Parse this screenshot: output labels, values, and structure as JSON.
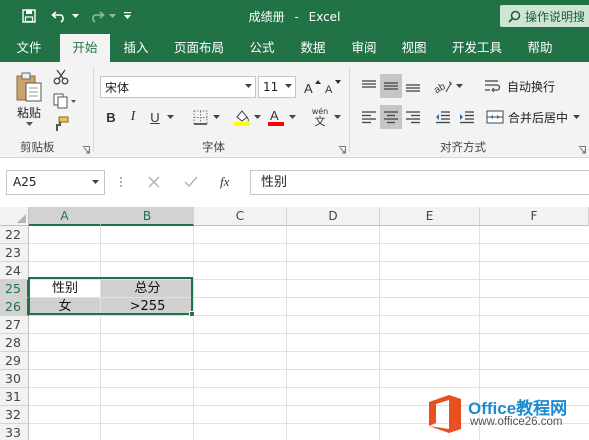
{
  "titlebar": {
    "doc_title": "成绩册",
    "separator": "-",
    "app_name": "Excel",
    "tell_me": "操作说明搜",
    "bg_color": "#217346"
  },
  "tabs": [
    {
      "label": "文件",
      "active": false
    },
    {
      "label": "开始",
      "active": true
    },
    {
      "label": "插入",
      "active": false
    },
    {
      "label": "页面布局",
      "active": false
    },
    {
      "label": "公式",
      "active": false
    },
    {
      "label": "数据",
      "active": false
    },
    {
      "label": "审阅",
      "active": false
    },
    {
      "label": "视图",
      "active": false
    },
    {
      "label": "开发工具",
      "active": false
    },
    {
      "label": "帮助",
      "active": false
    }
  ],
  "ribbon": {
    "clipboard": {
      "paste_label": "粘贴",
      "group_label": "剪贴板"
    },
    "font": {
      "font_name": "宋体",
      "font_size": "11",
      "bold": "B",
      "italic": "I",
      "underline": "U",
      "phonetic": "wén",
      "group_label": "字体",
      "highlight_color": "#ffff00",
      "font_color": "#ff0000"
    },
    "alignment": {
      "wrap_text": "自动换行",
      "merge_center": "合并后居中",
      "group_label": "对齐方式"
    }
  },
  "formula_bar": {
    "name_box": "A25",
    "fx": "fx",
    "content": "性别"
  },
  "sheet": {
    "columns": [
      "A",
      "B",
      "C",
      "D",
      "E",
      "F"
    ],
    "selected_columns": [
      "A",
      "B"
    ],
    "rows": [
      "22",
      "23",
      "24",
      "25",
      "26",
      "27",
      "28",
      "29",
      "30",
      "31",
      "32",
      "33"
    ],
    "selected_rows": [
      "25",
      "26"
    ],
    "cells": {
      "A25": "性别",
      "B25": "总分",
      "A26": "女",
      "B26": ">255"
    },
    "accent": "#217346"
  },
  "watermark": {
    "title": "Office教程网",
    "url": "www.office26.com"
  }
}
